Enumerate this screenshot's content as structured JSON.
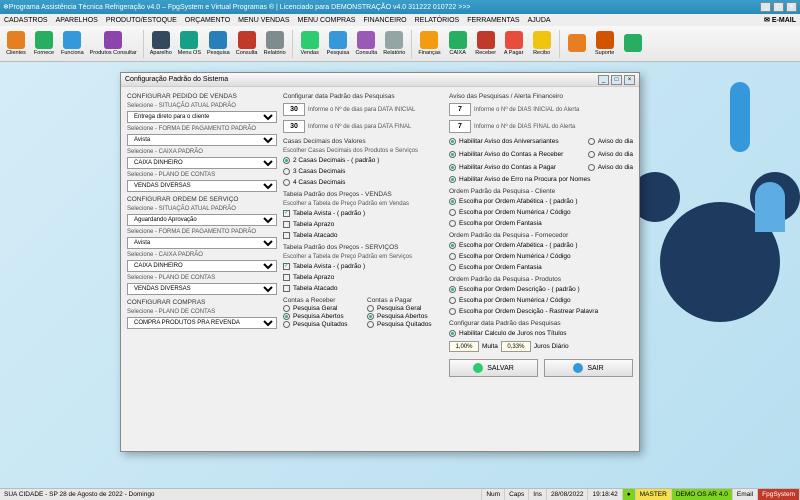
{
  "title": "Programa Assistência Técnica Refrigeração v4.0 – FpgSystem e Virtual Programas ® | Licenciado para  DEMONSTRAÇÃO v4.0 311222 010722  >>>",
  "menu": [
    "CADASTROS",
    "APARELHOS",
    "PRODUTO/ESTOQUE",
    "ORÇAMENTO",
    "MENU VENDAS",
    "MENU COMPRAS",
    "FINANCEIRO",
    "RELATÓRIOS",
    "FERRAMENTAS",
    "AJUDA"
  ],
  "menu_email": "E-MAIL",
  "toolbar": [
    {
      "label": "Clientes",
      "color": "#e67e22"
    },
    {
      "label": "Fornece",
      "color": "#27ae60"
    },
    {
      "label": "Funciona",
      "color": "#3498db"
    },
    {
      "label": "Produtos Consultar",
      "color": "#8e44ad"
    },
    {
      "label": "Aparelho",
      "color": "#34495e"
    },
    {
      "label": "Menu OS",
      "color": "#16a085"
    },
    {
      "label": "Pesquisa",
      "color": "#2980b9"
    },
    {
      "label": "Consulta",
      "color": "#c0392b"
    },
    {
      "label": "Relatório",
      "color": "#7f8c8d"
    },
    {
      "label": "Vendas",
      "color": "#2ecc71"
    },
    {
      "label": "Pesquisa",
      "color": "#3498db"
    },
    {
      "label": "Consulta",
      "color": "#9b59b6"
    },
    {
      "label": "Relatório",
      "color": "#95a5a6"
    },
    {
      "label": "Finanças",
      "color": "#f39c12"
    },
    {
      "label": "CAIXA",
      "color": "#27ae60"
    },
    {
      "label": "Receber",
      "color": "#c0392b"
    },
    {
      "label": "A Pagar",
      "color": "#e74c3c"
    },
    {
      "label": "Recibo",
      "color": "#f1c40f"
    },
    {
      "label": "",
      "color": "#e67e22"
    },
    {
      "label": "Suporte",
      "color": "#d35400"
    },
    {
      "label": "",
      "color": "#27ae60"
    }
  ],
  "dialog": {
    "title": "Configuração Padrão do Sistema",
    "col1": {
      "h1": "CONFIGURAR PEDIDO DE VENDAS",
      "l1": "Selecione - SITUAÇÃO ATUAL PADRÃO",
      "v1": "Entrega direto para o cliente",
      "l2": "Selecione - FORMA DE PAGAMENTO PADRÃO",
      "v2": "Avista",
      "l3": "Selecione - CAIXA PADRÃO",
      "v3": "CAIXA DINHEIRO",
      "l4": "Selecione - PLANO DE CONTAS",
      "v4": "VENDAS DIVERSAS",
      "h2": "CONFIGURAR ORDEM DE SERVIÇO",
      "l5": "Selecione - SITUAÇÃO ATUAL PADRÃO",
      "v5": "Aguardando Aprovação",
      "l6": "Selecione - FORMA DE PAGAMENTO PADRÃO",
      "v6": "Avista",
      "l7": "Selecione - CAIXA PADRÃO",
      "v7": "CAIXA DINHEIRO",
      "l8": "Selecione - PLANO DE CONTAS",
      "v8": "VENDAS DIVERSAS",
      "h3": "CONFIGURAR COMPRAS",
      "l9": "Selecione - PLANO DE CONTAS",
      "v9": "COMPRA PRODUTOS PRA REVENDA"
    },
    "col2": {
      "h1": "Configurar data Padrão das Pesquisas",
      "n1": "30",
      "t1": "Informe o Nº de dias para DATA INICIAL",
      "n2": "30",
      "t2": "Informe o Nº de dias para DATA FINAL",
      "h2": "Casas Decimais dos Valores",
      "sub2": "Escolher Casas Decimais dos Produtos e Serviços",
      "r1": "2 Casas Decimais - ( padrão )",
      "r2": "3 Casas Decimais",
      "r3": "4 Casas Decimais",
      "h3": "Tabela Padrão dos Preços - VENDAS",
      "sub3": "Escolher a Tabela de Preço Padrão em Vendas",
      "c1": "Tabela Avista - ( padrão )",
      "c2": "Tabela Aprazo",
      "c3": "Tabela Atacado",
      "h4": "Tabela Padrão dos Preços - SERVIÇOS",
      "sub4": "Escolher a Tabela de Preço Padrão em Serviços",
      "c4": "Tabela Avista - ( padrão )",
      "c5": "Tabela Aprazo",
      "c6": "Tabela Atacado",
      "hr": "Contas a Receber",
      "hp": "Contas a Pagar",
      "rg": "Pesquisa Geral",
      "ra": "Pesquisa Abertos",
      "rq": "Pesquisa Quitados"
    },
    "col3": {
      "h1": "Aviso das Pesquisas / Alerta Financeiro",
      "n1": "7",
      "t1": "Informe o Nº de DIAS INICIAL do Alerta",
      "n2": "7",
      "t2": "Informe o Nº de DIAS FINAL do Alerta",
      "a1": "Habilitar Aviso dos Aniversariantes",
      "ad": "Aviso do dia",
      "a2": "Habilitar Aviso do Contas a Receber",
      "a3": "Habilitar Aviso do Contas a Pagar",
      "a4": "Habilitar Aviso de Erro na Procura por Nomes",
      "h2": "Ordem Padrão da Pesquisa - Cliente",
      "o1": "Escolha por Ordem Afabética - ( padrão )",
      "o2": "Escolha por Ordem Numérica / Código",
      "o3": "Escolha por Ordem Fantasia",
      "h3": "Ordem Padrão da Pesquisa - Fornecedor",
      "h4": "Ordem Padrão da Pesquisa - Produtos",
      "p1": "Escolha por Ordem Descrição - ( padrão )",
      "p2": "Escolha por Ordem Numérica / Código",
      "p3": "Escolha por Ordem Descição - Rastrear Palavra",
      "h5": "Configurar data Padrão das Pesquisas",
      "hj": "Habilitar Calculo de Juros nos Títulos",
      "pct1": "1,00%",
      "ml": "Multa",
      "pct2": "0,33%",
      "jd": "Juros Diário"
    },
    "btn_save": "SALVAR",
    "btn_exit": "SAIR"
  },
  "status": {
    "left": "SUA CIDADE - SP 28 de Agosto de 2022  - Domingo",
    "num": "Num",
    "caps": "Caps",
    "ins": "Ins",
    "date": "28/08/2022",
    "time": "19:18:42",
    "master": "MASTER",
    "demo": "DEMO OS AR 4.0",
    "email": "Email",
    "brand": "FpgSystem"
  }
}
